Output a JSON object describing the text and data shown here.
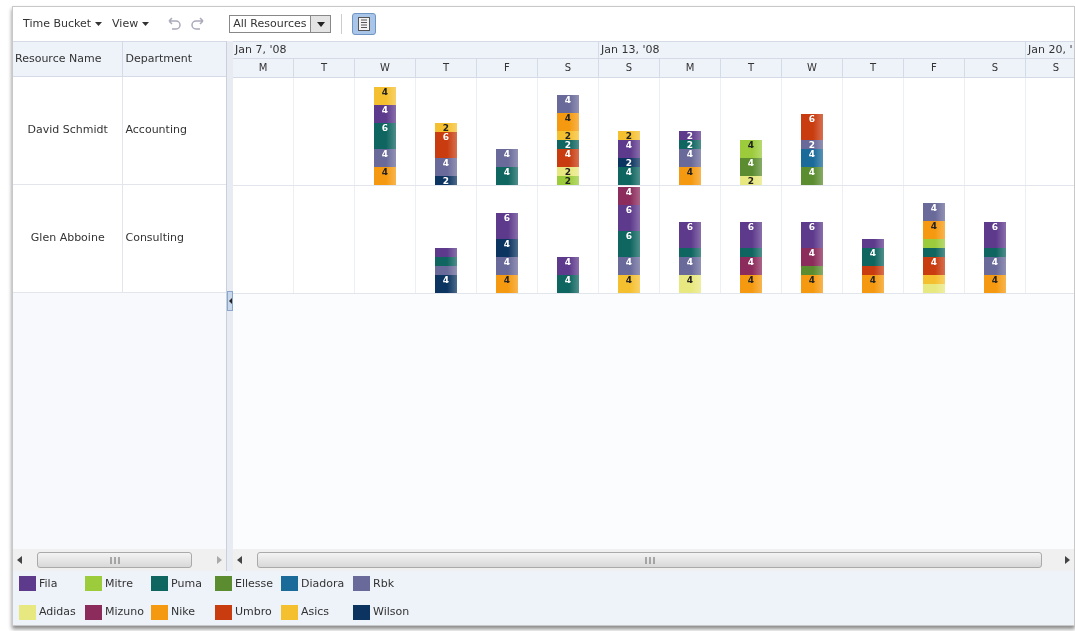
{
  "toolbar": {
    "menus": [
      {
        "label": "Time Bucket"
      },
      {
        "label": "View"
      }
    ],
    "resource_filter": {
      "value": "All Resources"
    },
    "legend_toggle": {
      "selected": true
    }
  },
  "table": {
    "columns": [
      "Resource Name",
      "Department"
    ]
  },
  "timeline": {
    "days": [
      {
        "label": "M",
        "week": "Jan 7, '08"
      },
      {
        "label": "T"
      },
      {
        "label": "W"
      },
      {
        "label": "T"
      },
      {
        "label": "F"
      },
      {
        "label": "S"
      },
      {
        "label": "S",
        "week": "Jan 13, '08"
      },
      {
        "label": "M"
      },
      {
        "label": "T"
      },
      {
        "label": "W"
      },
      {
        "label": "T"
      },
      {
        "label": "F"
      },
      {
        "label": "S"
      },
      {
        "label": "S",
        "week": "Jan 20, '"
      }
    ]
  },
  "rows": [
    {
      "name": "David Schmidt",
      "department": "Accounting",
      "days": [
        {
          "kind": "empty"
        },
        {
          "kind": "empty"
        },
        {
          "kind": "bar",
          "segments": [
            {
              "kind": "labeled",
              "color": "#f5c030",
              "label": "4"
            },
            {
              "kind": "labeled",
              "color": "#5e3a8c",
              "label": "4"
            },
            {
              "kind": "labeled",
              "color": "#0f6560",
              "label": "6"
            },
            {
              "kind": "labeled",
              "color": "#6a6a9a",
              "label": "4"
            },
            {
              "kind": "labeled",
              "color": "#f59a10",
              "label": "4"
            }
          ]
        },
        {
          "kind": "bar",
          "segments": [
            {
              "kind": "labeled",
              "color": "#f5c030",
              "label": "2"
            },
            {
              "kind": "labeled",
              "color": "#c83c10",
              "label": "6"
            },
            {
              "kind": "labeled",
              "color": "#6a6a9a",
              "label": "4"
            },
            {
              "kind": "labeled",
              "color": "#0c3460",
              "label": "2"
            }
          ]
        },
        {
          "kind": "bar",
          "segments": [
            {
              "kind": "labeled",
              "color": "#6a6a9a",
              "label": "4"
            },
            {
              "kind": "labeled",
              "color": "#0f6560",
              "label": "4"
            }
          ]
        },
        {
          "kind": "bar",
          "segments": [
            {
              "kind": "labeled",
              "color": "#6a6a9a",
              "label": "4"
            },
            {
              "kind": "labeled",
              "color": "#f59a10",
              "label": "4"
            },
            {
              "kind": "labeled",
              "color": "#f5c030",
              "label": "2"
            },
            {
              "kind": "labeled",
              "color": "#0f6560",
              "label": "2"
            },
            {
              "kind": "labeled",
              "color": "#c83c10",
              "label": "4"
            },
            {
              "kind": "labeled",
              "color": "#e8e880",
              "label": "2"
            },
            {
              "kind": "labeled",
              "color": "#9ccc3c",
              "label": "2"
            }
          ]
        },
        {
          "kind": "bar",
          "segments": [
            {
              "kind": "labeled",
              "color": "#f5c030",
              "label": "2"
            },
            {
              "kind": "labeled",
              "color": "#5e3a8c",
              "label": "4"
            },
            {
              "kind": "labeled",
              "color": "#0c3460",
              "label": "2"
            },
            {
              "kind": "labeled",
              "color": "#0f6560",
              "label": "4"
            }
          ]
        },
        {
          "kind": "bar",
          "segments": [
            {
              "kind": "labeled",
              "color": "#5e3a8c",
              "label": "2"
            },
            {
              "kind": "labeled",
              "color": "#0f6560",
              "label": "2"
            },
            {
              "kind": "labeled",
              "color": "#6a6a9a",
              "label": "4"
            },
            {
              "kind": "labeled",
              "color": "#f59a10",
              "label": "4"
            }
          ]
        },
        {
          "kind": "bar",
          "segments": [
            {
              "kind": "labeled",
              "color": "#9ccc3c",
              "label": "4"
            },
            {
              "kind": "labeled",
              "color": "#5b8c30",
              "label": "4"
            },
            {
              "kind": "labeled",
              "color": "#e8e880",
              "label": "2"
            }
          ]
        },
        {
          "kind": "bar",
          "segments": [
            {
              "kind": "labeled",
              "color": "#c83c10",
              "label": "6"
            },
            {
              "kind": "labeled",
              "color": "#6a6a9a",
              "label": "2"
            },
            {
              "kind": "labeled",
              "color": "#1a6a9a",
              "label": "4"
            },
            {
              "kind": "labeled",
              "color": "#5b8c30",
              "label": "4"
            }
          ]
        },
        {
          "kind": "empty"
        },
        {
          "kind": "empty"
        },
        {
          "kind": "empty"
        },
        {
          "kind": "empty"
        }
      ]
    },
    {
      "name": "Glen Abboine",
      "department": "Consulting",
      "days": [
        {
          "kind": "empty"
        },
        {
          "kind": "empty"
        },
        {
          "kind": "empty"
        },
        {
          "kind": "bar",
          "segments": [
            {
              "kind": "unlabeled",
              "color": "#5e3a8c"
            },
            {
              "kind": "unlabeled",
              "color": "#0f6560"
            },
            {
              "kind": "unlabeled",
              "color": "#6a6a9a"
            },
            {
              "kind": "labeled",
              "color": "#0c3460",
              "label": "4"
            }
          ]
        },
        {
          "kind": "bar",
          "segments": [
            {
              "kind": "labeled",
              "color": "#5e3a8c",
              "label": "6"
            },
            {
              "kind": "labeled",
              "color": "#0c3460",
              "label": "4"
            },
            {
              "kind": "labeled",
              "color": "#6a6a9a",
              "label": "4"
            },
            {
              "kind": "labeled",
              "color": "#f59a10",
              "label": "4"
            }
          ]
        },
        {
          "kind": "bar",
          "segments": [
            {
              "kind": "labeled",
              "color": "#5e3a8c",
              "label": "4"
            },
            {
              "kind": "labeled",
              "color": "#0f6560",
              "label": "4"
            }
          ]
        },
        {
          "kind": "bar",
          "segments": [
            {
              "kind": "labeled",
              "color": "#8c2c5c",
              "label": "4"
            },
            {
              "kind": "labeled",
              "color": "#5e3a8c",
              "label": "6"
            },
            {
              "kind": "labeled",
              "color": "#0f6560",
              "label": "6"
            },
            {
              "kind": "labeled",
              "color": "#6a6a9a",
              "label": "4"
            },
            {
              "kind": "labeled",
              "color": "#f5c030",
              "label": "4"
            }
          ]
        },
        {
          "kind": "bar",
          "segments": [
            {
              "kind": "labeled",
              "color": "#5e3a8c",
              "label": "6"
            },
            {
              "kind": "unlabeled",
              "color": "#0f6560"
            },
            {
              "kind": "labeled",
              "color": "#6a6a9a",
              "label": "4"
            },
            {
              "kind": "labeled",
              "color": "#e8e880",
              "label": "4"
            }
          ]
        },
        {
          "kind": "bar",
          "segments": [
            {
              "kind": "labeled",
              "color": "#5e3a8c",
              "label": "6"
            },
            {
              "kind": "unlabeled",
              "color": "#0f6560"
            },
            {
              "kind": "labeled",
              "color": "#8c2c5c",
              "label": "4"
            },
            {
              "kind": "labeled",
              "color": "#f59a10",
              "label": "4"
            }
          ]
        },
        {
          "kind": "bar",
          "segments": [
            {
              "kind": "labeled",
              "color": "#5e3a8c",
              "label": "6"
            },
            {
              "kind": "labeled",
              "color": "#8c2c5c",
              "label": "4"
            },
            {
              "kind": "unlabeled",
              "color": "#5b8c30"
            },
            {
              "kind": "labeled",
              "color": "#f59a10",
              "label": "4"
            }
          ]
        },
        {
          "kind": "bar",
          "segments": [
            {
              "kind": "unlabeled",
              "color": "#5e3a8c"
            },
            {
              "kind": "labeled",
              "color": "#0f6560",
              "label": "4"
            },
            {
              "kind": "unlabeled",
              "color": "#c83c10"
            },
            {
              "kind": "labeled",
              "color": "#f59a10",
              "label": "4"
            }
          ]
        },
        {
          "kind": "bar",
          "segments": [
            {
              "kind": "labeled",
              "color": "#6a6a9a",
              "label": "4"
            },
            {
              "kind": "labeled",
              "color": "#f59a10",
              "label": "4"
            },
            {
              "kind": "unlabeled",
              "color": "#9ccc3c"
            },
            {
              "kind": "unlabeled",
              "color": "#0f6560"
            },
            {
              "kind": "labeled",
              "color": "#c83c10",
              "label": "4"
            },
            {
              "kind": "unlabeled",
              "color": "#f5c030"
            },
            {
              "kind": "unlabeled",
              "color": "#e8e880"
            }
          ]
        },
        {
          "kind": "bar",
          "segments": [
            {
              "kind": "labeled",
              "color": "#5e3a8c",
              "label": "6"
            },
            {
              "kind": "unlabeled",
              "color": "#0f6560"
            },
            {
              "kind": "labeled",
              "color": "#6a6a9a",
              "label": "4"
            },
            {
              "kind": "labeled",
              "color": "#f59a10",
              "label": "4"
            }
          ]
        },
        {
          "kind": "empty"
        }
      ]
    }
  ],
  "legend": [
    {
      "name": "Fila",
      "color": "#5e3a8c"
    },
    {
      "name": "Mitre",
      "color": "#9ccc3c"
    },
    {
      "name": "Puma",
      "color": "#0f6560"
    },
    {
      "name": "Ellesse",
      "color": "#5b8c30"
    },
    {
      "name": "Diadora",
      "color": "#1a6a9a"
    },
    {
      "name": "Rbk",
      "color": "#6a6a9a"
    },
    {
      "name": "Adidas",
      "color": "#e8e880"
    },
    {
      "name": "Mizuno",
      "color": "#8c2c5c"
    },
    {
      "name": "Nike",
      "color": "#f59a10"
    },
    {
      "name": "Umbro",
      "color": "#c83c10"
    },
    {
      "name": "Asics",
      "color": "#f5c030"
    },
    {
      "name": "Wilson",
      "color": "#0c3460"
    }
  ]
}
